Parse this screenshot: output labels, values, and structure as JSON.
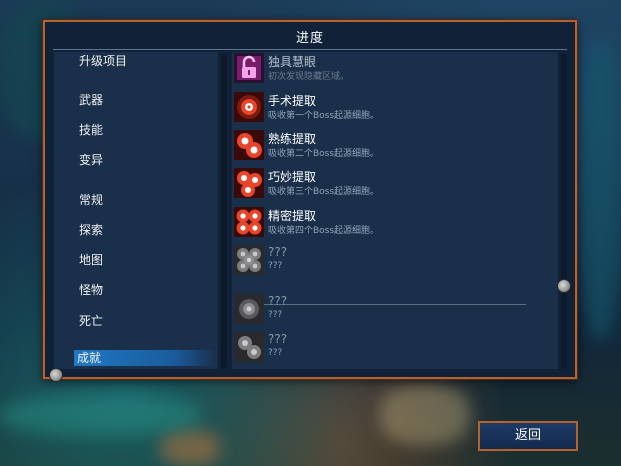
{
  "panel": {
    "title": "进度"
  },
  "categories": [
    {
      "label": "升级项目",
      "name": "category-upgrades"
    },
    {
      "label": "武器",
      "name": "category-weapons"
    },
    {
      "label": "技能",
      "name": "category-skills"
    },
    {
      "label": "变异",
      "name": "category-mutations"
    },
    {
      "label": "常规",
      "name": "category-general"
    },
    {
      "label": "探索",
      "name": "category-exploration"
    },
    {
      "label": "地图",
      "name": "category-map"
    },
    {
      "label": "怪物",
      "name": "category-monsters"
    },
    {
      "label": "死亡",
      "name": "category-deaths"
    },
    {
      "label": "成就",
      "name": "category-achievements",
      "active": true
    }
  ],
  "achievements": [
    {
      "name": "独具慧眼",
      "desc": "初次发现隐藏区域。",
      "icon": "padlock-unlocked-icon",
      "state": "dim"
    },
    {
      "name": "手术提取",
      "desc": "吸收第一个Boss起源细胞。",
      "icon": "boss-cell-1-icon",
      "state": "unlocked"
    },
    {
      "name": "熟练提取",
      "desc": "吸收第二个Boss起源细胞。",
      "icon": "boss-cell-2-icon",
      "state": "unlocked"
    },
    {
      "name": "巧妙提取",
      "desc": "吸收第三个Boss起源细胞。",
      "icon": "boss-cell-3-icon",
      "state": "unlocked"
    },
    {
      "name": "精密提取",
      "desc": "吸收第四个Boss起源细胞。",
      "icon": "boss-cell-4-icon",
      "state": "unlocked"
    },
    {
      "name": "???",
      "desc": "???",
      "icon": "locked-cells-icon",
      "state": "locked"
    },
    {
      "name": "???",
      "desc": "???",
      "icon": "locked-cell-icon",
      "state": "locked"
    },
    {
      "name": "???",
      "desc": "???",
      "icon": "locked-cell-icon",
      "state": "locked"
    }
  ],
  "buttons": {
    "back_label": "返回"
  },
  "colors": {
    "panel_border": "#b5622f",
    "panel_bg": "#112238",
    "active_tab": "#1f78c4",
    "cell_red": "#e8452a"
  }
}
